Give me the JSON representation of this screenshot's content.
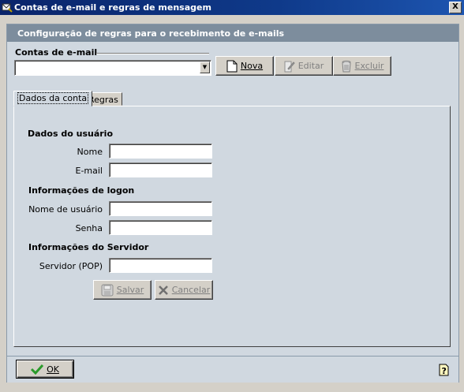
{
  "window": {
    "title": "Contas de e-mail e regras de mensagem",
    "close_glyph": "X"
  },
  "header": {
    "title": "Configuração de regras para o recebimento de e-mails"
  },
  "accounts": {
    "section_label": "Contas de e-mail",
    "combo_value": "",
    "buttons": {
      "nova": "Nova",
      "editar": "Editar",
      "excluir": "Excluir"
    }
  },
  "tabs": [
    {
      "label": "Dados da conta",
      "active": true
    },
    {
      "label": "Regras",
      "active": false
    }
  ],
  "form": {
    "user_section": "Dados do usuário",
    "nome_label": "Nome",
    "nome_value": "",
    "email_label": "E-mail",
    "email_value": "",
    "logon_section": "Informações de logon",
    "username_label": "Nome de usuário",
    "username_value": "",
    "senha_label": "Senha",
    "senha_value": "",
    "server_section": "Informações do Servidor",
    "pop_label": "Servidor (POP)",
    "pop_value": "",
    "salvar": "Salvar",
    "cancelar": "Cancelar"
  },
  "footer": {
    "ok": "OK"
  }
}
